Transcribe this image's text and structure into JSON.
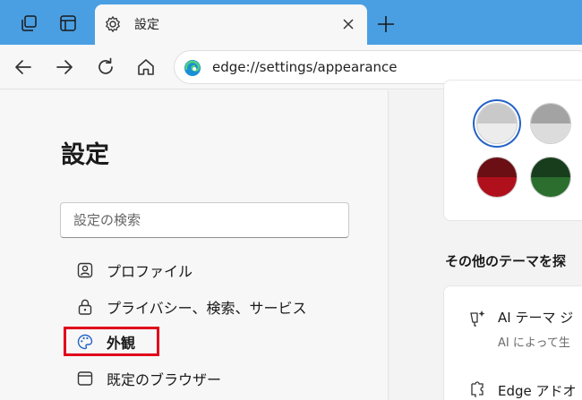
{
  "tab": {
    "title": "設定"
  },
  "address": {
    "url": "edge://settings/appearance"
  },
  "sidebar": {
    "title": "設定",
    "search_placeholder": "設定の検索",
    "items": [
      {
        "label": "プロファイル",
        "icon": "profile-icon"
      },
      {
        "label": "プライバシー、検索、サービス",
        "icon": "lock-icon"
      },
      {
        "label": "外観",
        "icon": "palette-icon",
        "active": true
      },
      {
        "label": "既定のブラウザー",
        "icon": "browser-icon"
      }
    ]
  },
  "main": {
    "swatches": [
      {
        "name": "light-gray",
        "top": "#c9c9c9",
        "bottom": "#ececec",
        "selected": true
      },
      {
        "name": "gray",
        "top": "#a3a3a3",
        "bottom": "#dcdcdc"
      },
      {
        "name": "dark-red",
        "top": "#6b0f14",
        "bottom": "#b0101c"
      },
      {
        "name": "dark-green",
        "top": "#183d1c",
        "bottom": "#2b6e2e"
      }
    ],
    "section_heading": "その他のテーマを探",
    "options": [
      {
        "title": "AI テーマ ジ",
        "subtitle": "AI によって生",
        "icon": "ai-sparkle-icon"
      },
      {
        "title": "Edge アドオ",
        "icon": "puzzle-icon"
      }
    ]
  },
  "colors": {
    "tabstrip": "#4a9fe3",
    "accent": "#2563c7",
    "highlight_box": "#e0001b"
  }
}
